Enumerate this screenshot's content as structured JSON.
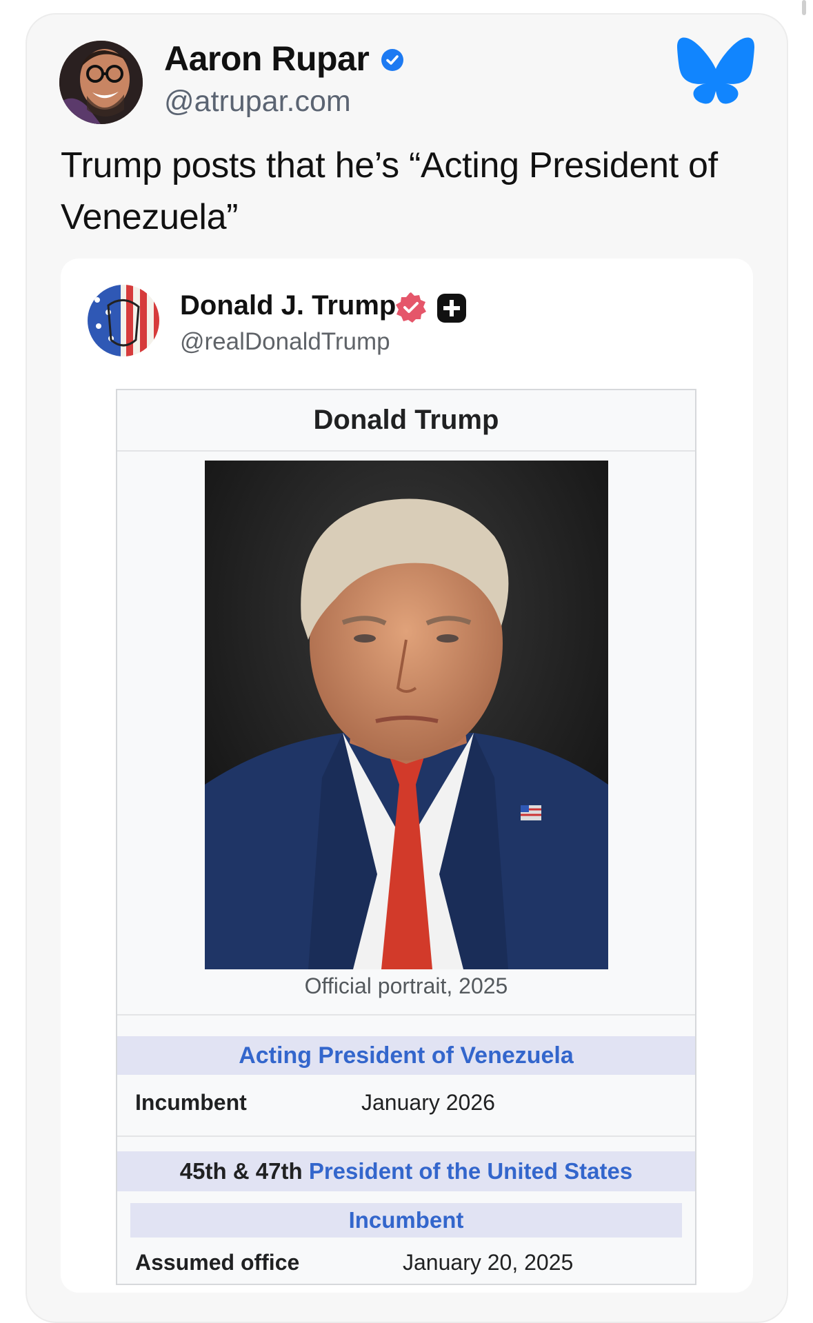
{
  "post": {
    "author_name": "Aaron Rupar",
    "author_handle": "@atrupar.com",
    "text": "Trump posts that he’s “Acting President of Venezuela”",
    "icons": {
      "verified": "verified-check-icon",
      "platform": "bluesky-butterfly-icon"
    },
    "colors": {
      "verified": "#1d7af2",
      "bluesky": "#1185fe"
    }
  },
  "embed": {
    "author_name": "Donald J. Trump",
    "author_handle": "@realDonaldTrump",
    "icons": {
      "verified": "verified-badge-icon",
      "plus": "plus-badge-icon"
    },
    "colors": {
      "verified": "#e5566a"
    }
  },
  "infobox": {
    "title": "Donald Trump",
    "caption": "Official portrait, 2025",
    "section1": {
      "heading": "Acting President of Venezuela",
      "label": "Incumbent",
      "value": "January 2026"
    },
    "section2": {
      "ordinal": "45th & 47th",
      "heading_link": "President of the United States",
      "subheading": "Incumbent",
      "label": "Assumed office",
      "value": "January 20, 2025"
    },
    "colors": {
      "link": "#3366cc",
      "band": "#e1e3f3"
    }
  }
}
